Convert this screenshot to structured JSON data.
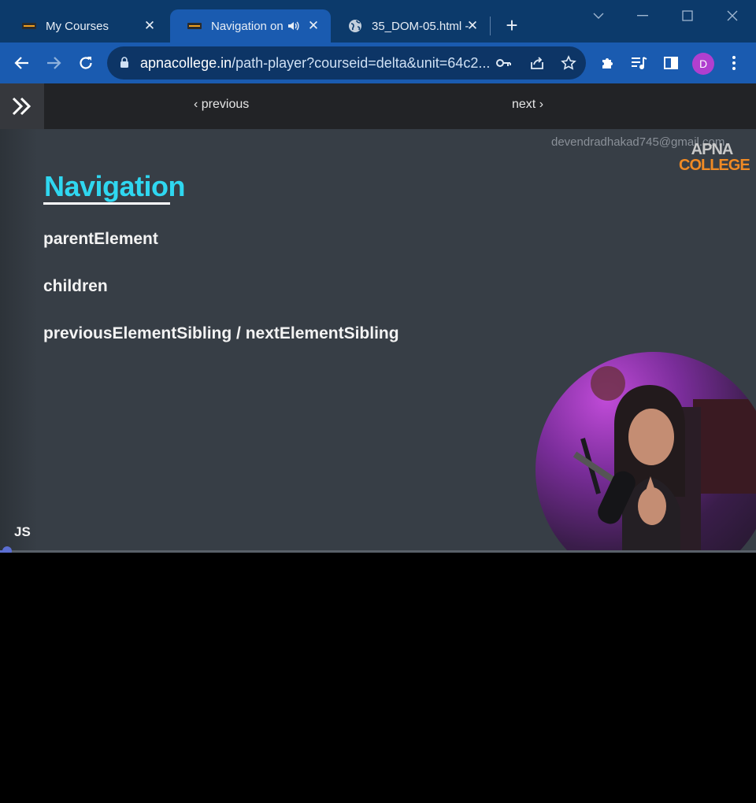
{
  "browser": {
    "tabs": [
      {
        "title": "My Courses",
        "favicon": "apnacollege-favicon",
        "active": false
      },
      {
        "title": "Navigation on",
        "favicon": "apnacollege-favicon",
        "active": true,
        "audio": "speaker-icon"
      },
      {
        "title": "35_DOM-05.html -",
        "favicon": "globe-icon",
        "active": false
      }
    ],
    "url_host": "apnacollege.in",
    "url_path": "/path-player?courseid=delta&unit=64c2...",
    "profile_initial": "D",
    "colors": {
      "tabstrip": "#0c3a6b",
      "active_tab": "#1a5bb0",
      "omnibox": "#0d3566",
      "avatar": "#b03fcf"
    }
  },
  "player": {
    "previous_label": "previous",
    "next_label": "next"
  },
  "video": {
    "watermark": "devendradhakad745@gmail.com",
    "logo_line1": "APNA",
    "logo_line2": "COLLEGE",
    "slide_title": "Navigation",
    "items": [
      "parentElement",
      "children",
      "previousElementSibling / nextElementSibling"
    ],
    "subject_label": "JS",
    "progress_fraction": 0.01,
    "colors": {
      "background": "#373e46",
      "title": "#2fd7f0",
      "logo_accent": "#f08a24",
      "progress": "#5b6ed1"
    }
  }
}
